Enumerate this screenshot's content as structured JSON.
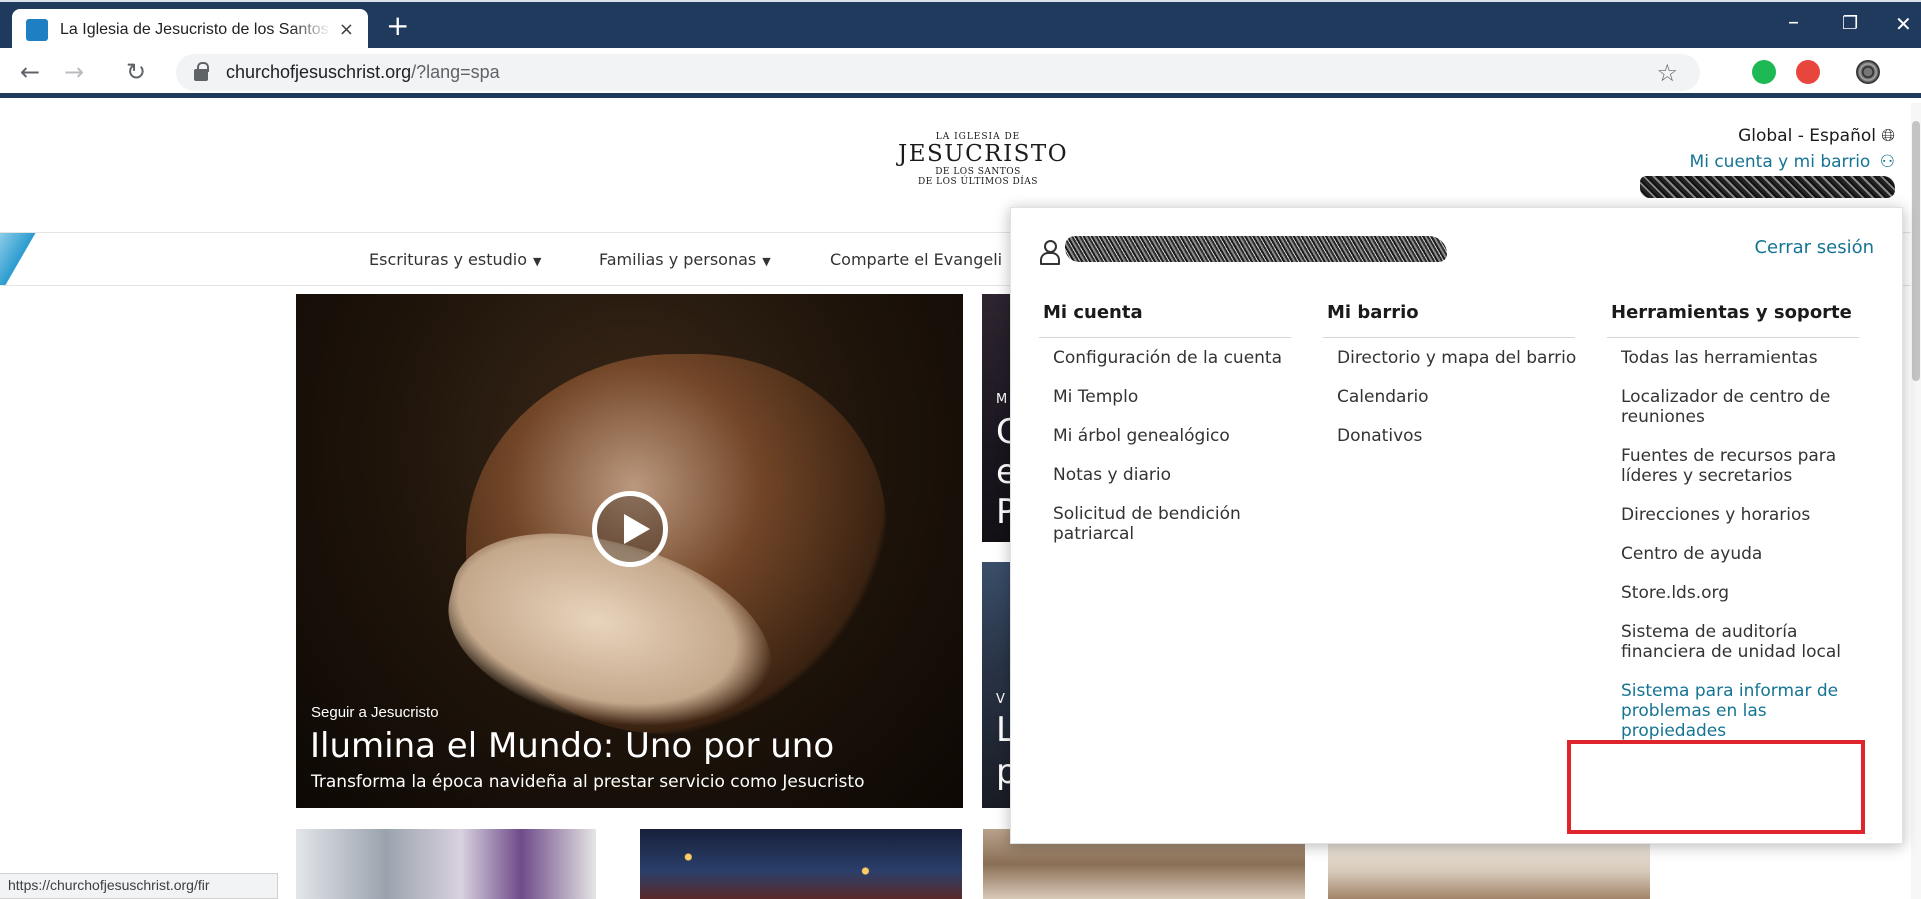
{
  "browser": {
    "tab_title": "La Iglesia de Jesucristo de los Santos de los Últimos Días",
    "tab_close": "×",
    "new_tab": "+",
    "url_host": "churchofjesuschrist.org",
    "url_path": "/?lang=spa",
    "window": {
      "minimize": "–",
      "maximize": "❐",
      "close": "✕"
    },
    "back": "←",
    "forward": "→",
    "reload": "↻",
    "star": "☆",
    "status_url": "https://churchofjesuschrist.org/fir"
  },
  "site": {
    "logo": {
      "line1": "LA IGLESIA DE",
      "line2": "JESUCRISTO",
      "line3": "DE LOS SANTOS",
      "line4": "DE LOS ÚLTIMOS DÍAS"
    },
    "language": "Global - Español",
    "account_link": "Mi cuenta y mi barrio",
    "nav": [
      "Escrituras y estudio",
      "Familias y personas",
      "Comparte el Evangeli"
    ],
    "hero": {
      "kicker": "Seguir a Jesucristo",
      "title": "Ilumina el Mundo: Uno por uno",
      "subtitle": "Transforma la época navideña al prestar servicio como Jesucristo"
    },
    "side_cards": [
      {
        "kicker": "M",
        "title_lines": [
          "C",
          "e",
          "P"
        ]
      },
      {
        "kicker": "V",
        "title_lines": [
          "L",
          "p"
        ]
      }
    ]
  },
  "dropdown": {
    "logout": "Cerrar sesión",
    "columns": [
      {
        "heading": "Mi cuenta",
        "items": [
          "Configuración de la cuenta",
          "Mi Templo",
          "Mi árbol genealógico",
          "Notas y diario",
          "Solicitud de bendición patriarcal"
        ]
      },
      {
        "heading": "Mi barrio",
        "items": [
          "Directorio y mapa del barrio",
          "Calendario",
          "Donativos"
        ]
      },
      {
        "heading": "Herramientas y soporte",
        "items": [
          "Todas las herramientas",
          "Localizador de centro de reuniones",
          "Fuentes de recursos para líderes y secretarios",
          "Direcciones y horarios",
          "Centro de ayuda",
          "Store.lds.org",
          "Sistema de auditoría financiera de unidad local",
          "Sistema para informar de problemas en las propiedades"
        ]
      }
    ]
  },
  "colors": {
    "chrome": "#1f3a5c",
    "link": "#157493",
    "highlight": "#e0242b"
  }
}
